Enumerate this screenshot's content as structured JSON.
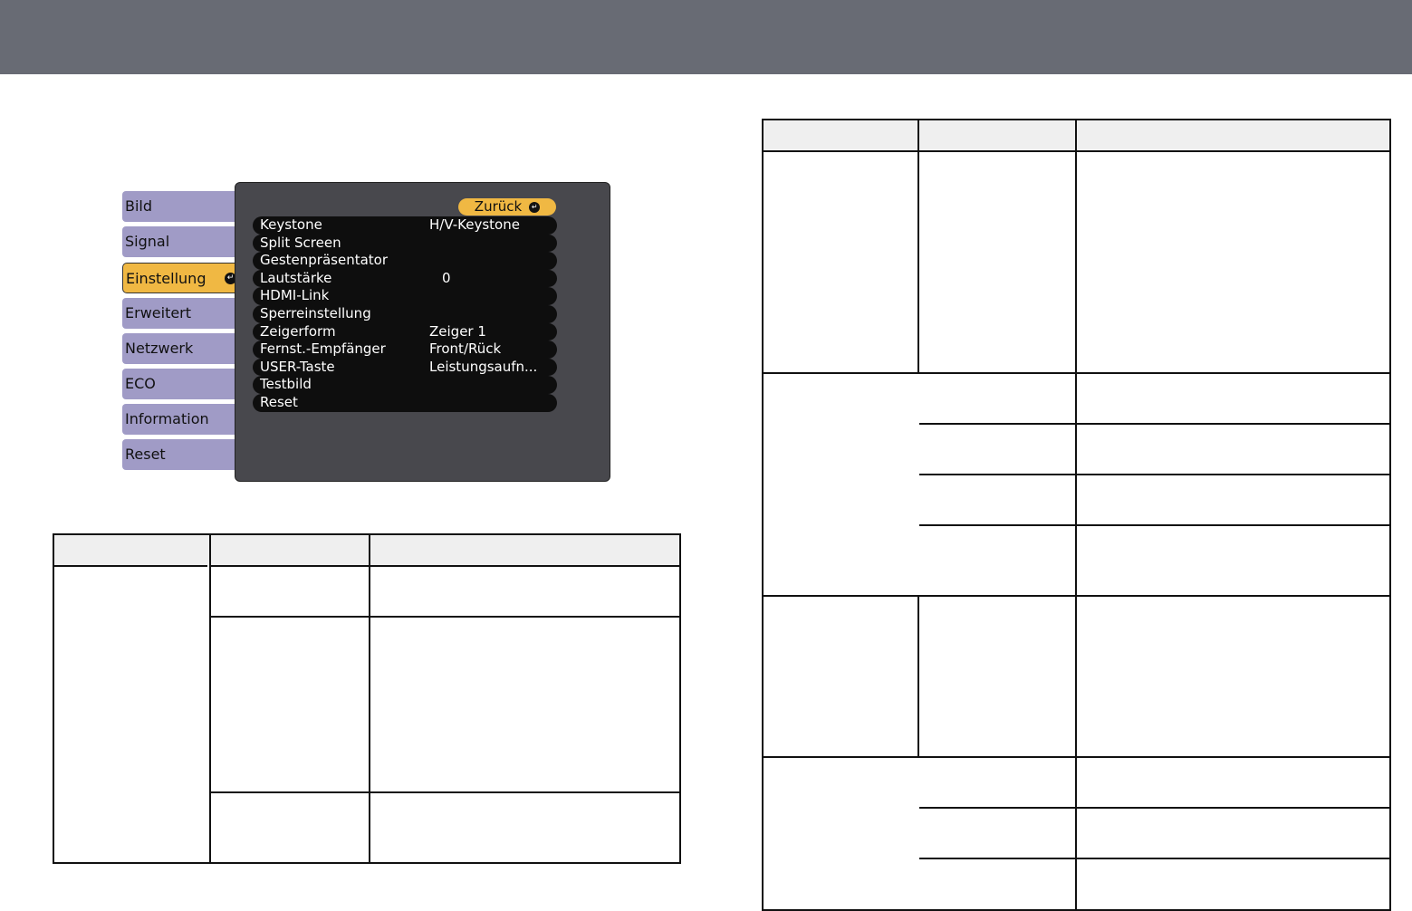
{
  "menu": {
    "tabs": [
      "Bild",
      "Signal",
      "Einstellung",
      "Erweitert",
      "Netzwerk",
      "ECO",
      "Information",
      "Reset"
    ],
    "active_tab": "Einstellung",
    "back_label": "Zurück",
    "items": [
      {
        "label": "Keystone",
        "value": "H/V-Keystone"
      },
      {
        "label": "Split Screen",
        "value": ""
      },
      {
        "label": "Gestenpräsentator",
        "value": ""
      },
      {
        "label": "Lautstärke",
        "value": "  0"
      },
      {
        "label": "HDMI-Link",
        "value": ""
      },
      {
        "label": "Sperreinstellung",
        "value": ""
      },
      {
        "label": "Zeigerform",
        "value": "Zeiger 1"
      },
      {
        "label": "Fernst.-Empfänger",
        "value": "Front/Rück"
      },
      {
        "label": "USER-Taste",
        "value": "Leistungsaufn..."
      },
      {
        "label": "Testbild",
        "value": ""
      },
      {
        "label": "Reset",
        "value": ""
      }
    ]
  }
}
